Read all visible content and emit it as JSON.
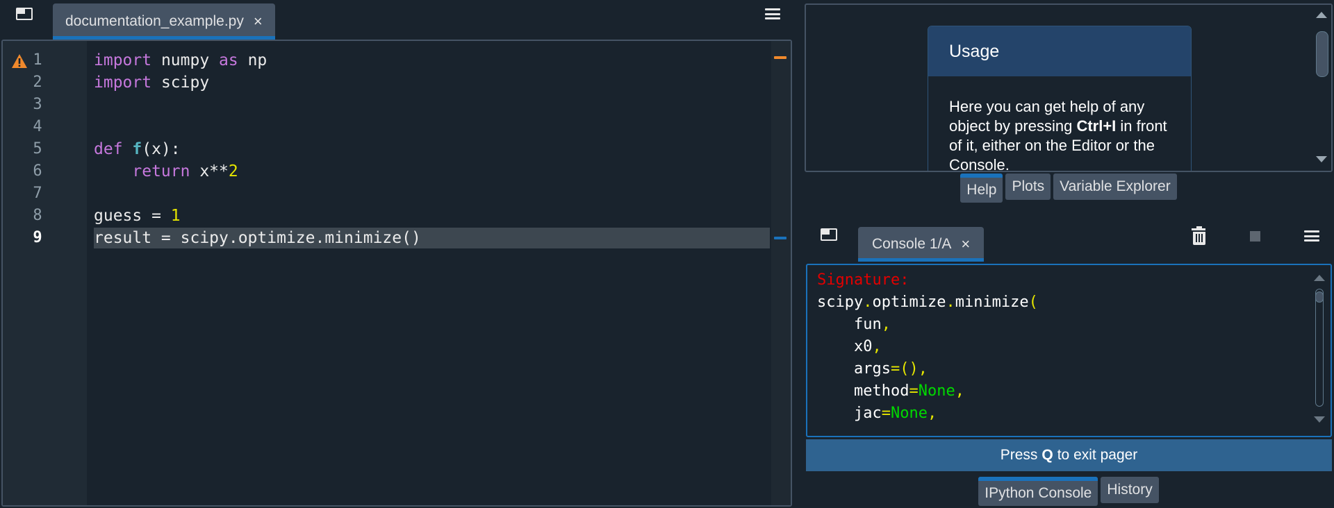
{
  "editor": {
    "tab_label": "documentation_example.py",
    "tab_close": "×",
    "line_numbers": [
      "1",
      "2",
      "3",
      "4",
      "5",
      "6",
      "7",
      "8",
      "9"
    ],
    "current_line": "9",
    "code": {
      "l1": {
        "kw1": "import",
        "a": " numpy ",
        "kw2": "as",
        "b": " np"
      },
      "l2": {
        "kw1": "import",
        "a": " scipy"
      },
      "l5": {
        "kw1": "def",
        "sp": " ",
        "fn": "f",
        "rest": "(x):"
      },
      "l6": {
        "indent": "    ",
        "kw1": "return",
        "a": " x**",
        "num": "2"
      },
      "l8": {
        "a": "guess = ",
        "num": "1"
      },
      "l9": {
        "a": "result = scipy.optimize.minimize()"
      }
    },
    "warning_line": "1"
  },
  "help": {
    "usage_title": "Usage",
    "usage_text_1": "Here you can get help of any object by pressing ",
    "usage_shortcut": "Ctrl+I",
    "usage_text_2": " in front of it, either on the Editor or the Console.",
    "tabs": [
      "Help",
      "Plots",
      "Variable Explorer"
    ],
    "active_tab": "Help"
  },
  "console": {
    "tab_label": "Console 1/A",
    "tab_close": "×",
    "output": {
      "signature_label": "Signature:",
      "call_prefix": "scipy",
      "dot": ".",
      "call_mid": "optimize",
      "call_end": "minimize",
      "paren_open": "(",
      "indent": "    ",
      "param_fun": "fun",
      "param_x0": "x0",
      "param_args": "args",
      "eq": "=",
      "args_default": "()",
      "param_method": "method",
      "param_jac": "jac",
      "none": "None",
      "comma": ","
    },
    "pager_prefix": "Press",
    "pager_key": "Q",
    "pager_suffix": "to exit pager",
    "tabs": [
      "IPython Console",
      "History"
    ],
    "active_tab": "IPython Console"
  },
  "colors": {
    "background": "#19232d",
    "accent": "#1a72bb",
    "keyword": "#c678dd",
    "number": "#e5e500",
    "warning": "#f0892c"
  },
  "icons": {
    "undock": "window-icon",
    "menu": "hamburger-menu-icon",
    "warning": "warning-triangle-icon",
    "trash": "trash-icon",
    "stop": "stop-square-icon"
  }
}
